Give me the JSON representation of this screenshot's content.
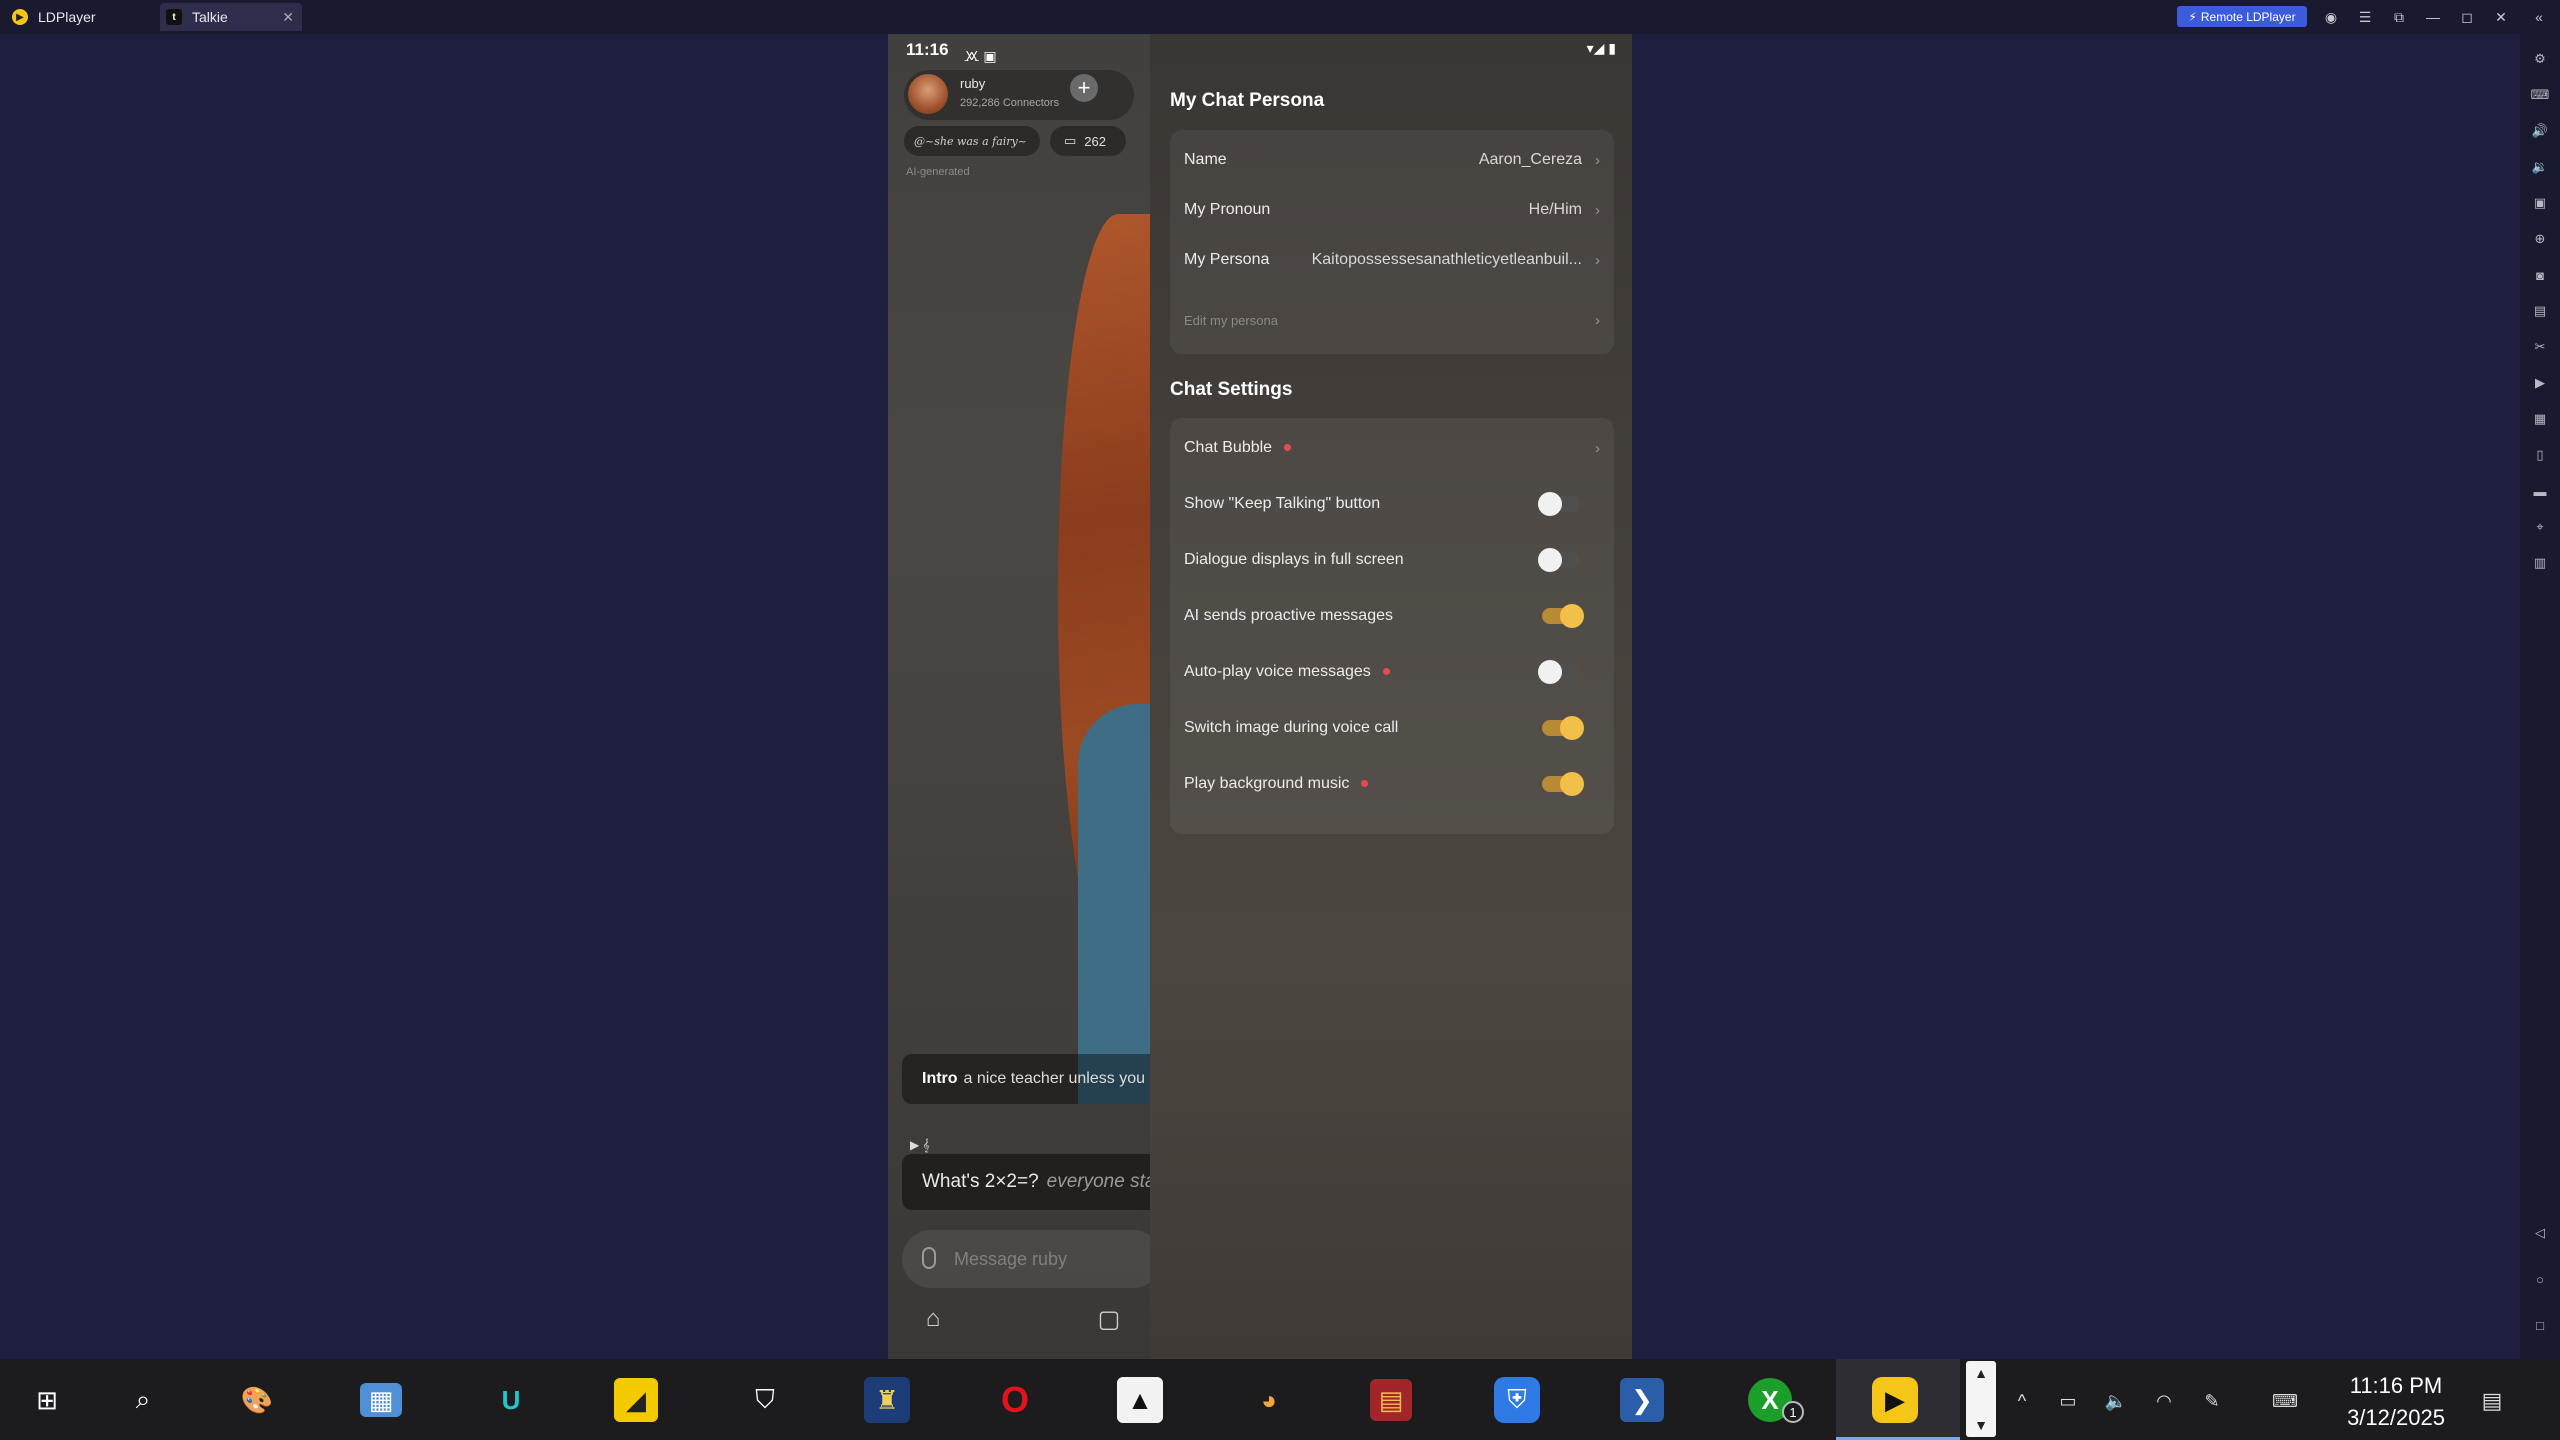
{
  "titlebar": {
    "tabs": [
      {
        "label": "LDPlayer"
      },
      {
        "label": "Talkie"
      }
    ],
    "remote_button": "Remote LDPlayer"
  },
  "phone": {
    "status_time": "11:16",
    "profile": {
      "name": "ruby",
      "subtitle": "292,286 Connectors"
    },
    "tag": "@~she was a fairy~",
    "message_count": "262",
    "ai_generated": "AI-generated",
    "intro_label": "Intro",
    "intro_text": "a nice teacher unless you",
    "chat_message": "What's 2×2=?",
    "chat_message_italic": "everyone sta",
    "input_placeholder": "Message ruby"
  },
  "panel": {
    "persona_title": "My Chat Persona",
    "persona_rows": [
      {
        "label": "Name",
        "value": "Aaron_Cereza"
      },
      {
        "label": "My Pronoun",
        "value": "He/Him"
      },
      {
        "label": "My Persona",
        "value": "Kaitopossessesanathleticyetleanbuil..."
      }
    ],
    "edit_persona": "Edit my persona",
    "settings_title": "Chat Settings",
    "chat_bubble": "Chat Bubble",
    "toggles": [
      {
        "label": "Show \"Keep Talking\" button",
        "on": false,
        "dot": false
      },
      {
        "label": "Dialogue displays in full screen",
        "on": false,
        "dot": false
      },
      {
        "label": "AI sends proactive messages",
        "on": true,
        "dot": false
      },
      {
        "label": "Auto-play voice messages",
        "on": false,
        "dot": true
      },
      {
        "label": "Switch image during voice call",
        "on": true,
        "dot": false
      },
      {
        "label": "Play background music",
        "on": true,
        "dot": true
      }
    ]
  },
  "taskbar": {
    "time": "11:16 PM",
    "date": "3/12/2025",
    "badge_count": "1"
  },
  "colors": {
    "desktop_bg": "#1e1e3f",
    "toggle_on": "#f2c049",
    "accent_dot": "#e74c4c",
    "remote_button": "#3b5bdb"
  }
}
